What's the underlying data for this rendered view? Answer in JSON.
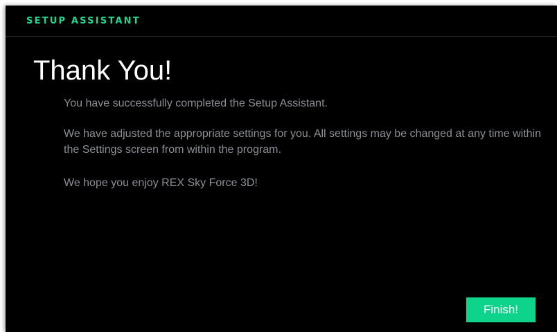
{
  "window": {
    "title": "SETUP ASSISTANT"
  },
  "main": {
    "heading": "Thank You!",
    "paragraphs": [
      "You have successfully completed the Setup Assistant.",
      "We have adjusted the appropriate settings for you. All settings may be changed at any time within the Settings screen from within the program.",
      "We hope you enjoy REX Sky Force 3D!"
    ]
  },
  "footer": {
    "finish_label": "Finish!"
  },
  "colors": {
    "accent": "#1ed692",
    "button": "#0ed38a",
    "background": "#000000",
    "body_text": "#8a8f96"
  }
}
